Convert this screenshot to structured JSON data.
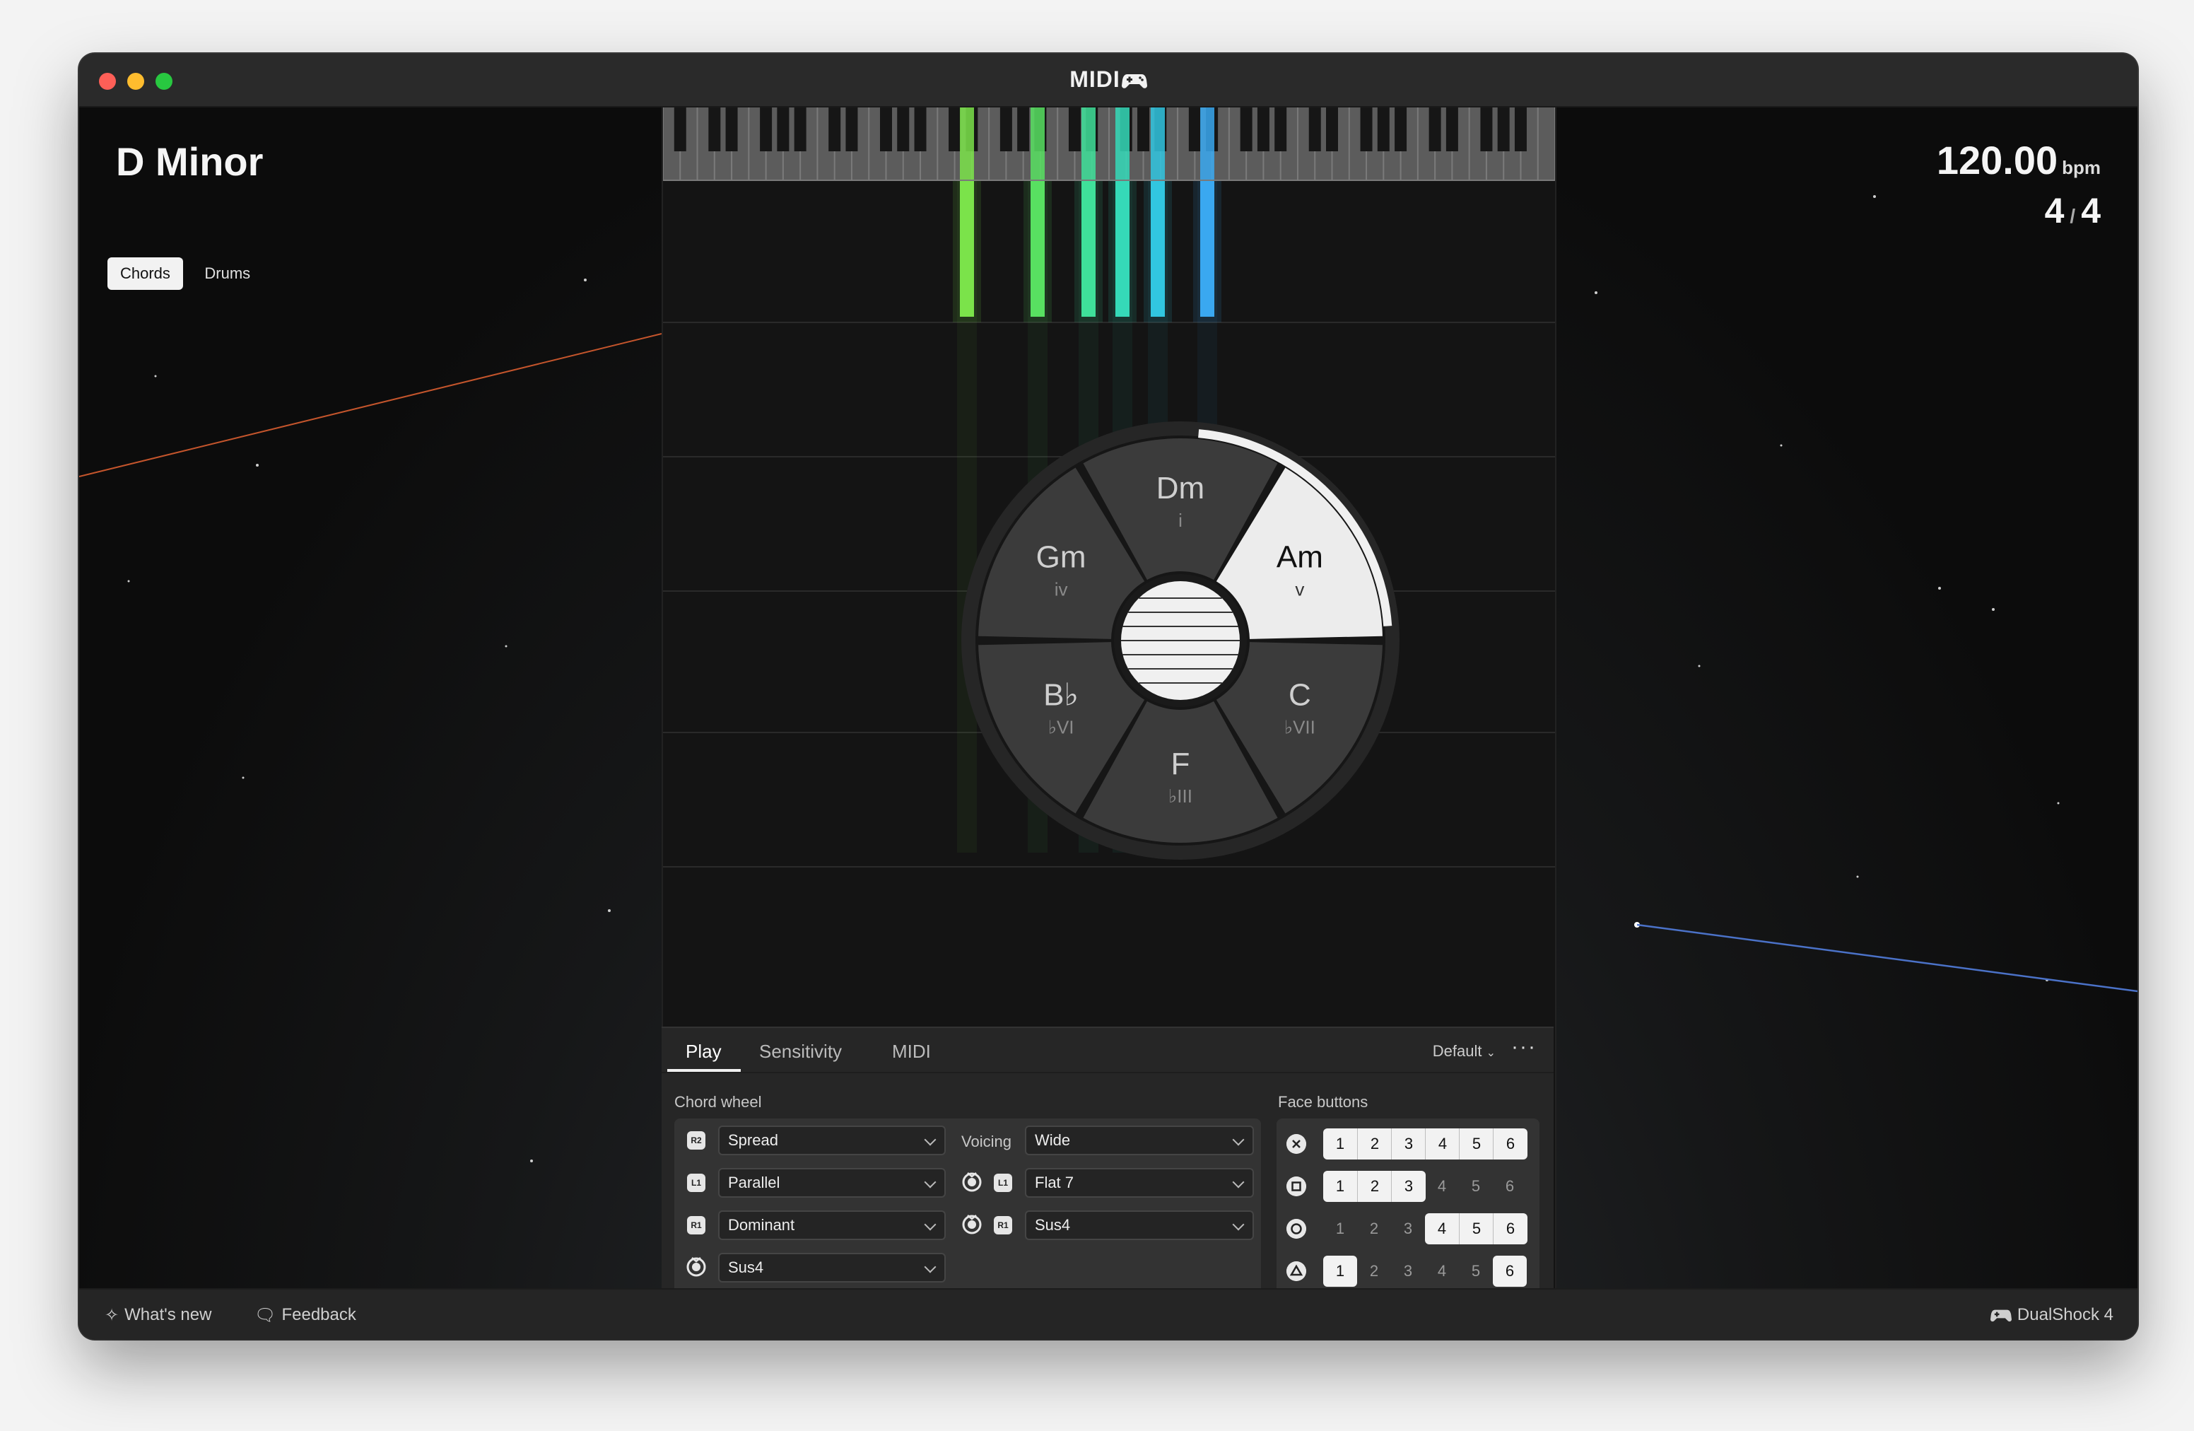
{
  "app": {
    "title": "MIDI"
  },
  "key": {
    "name": "D Minor"
  },
  "modes": [
    {
      "label": "Chords",
      "active": true
    },
    {
      "label": "Drums",
      "active": false
    }
  ],
  "tempo": {
    "bpm": "120.00",
    "unit": "bpm",
    "numerator": "4",
    "slash": "/",
    "denominator": "4"
  },
  "wheel": {
    "segments": [
      {
        "name": "Dm",
        "degree": "i",
        "active": false
      },
      {
        "name": "Am",
        "degree": "v",
        "active": true
      },
      {
        "name": "C",
        "degree": "♭VII",
        "active": false
      },
      {
        "name": "F",
        "degree": "♭III",
        "active": false
      },
      {
        "name": "B♭",
        "degree": "♭VI",
        "active": false
      },
      {
        "name": "Gm",
        "degree": "iv",
        "active": false
      }
    ]
  },
  "settings": {
    "tabs": [
      "Play",
      "Sensitivity",
      "MIDI"
    ],
    "active_tab": "Play",
    "preset": "Default",
    "more_icon": "ellipsis-icon",
    "chord_wheel": {
      "title": "Chord wheel",
      "rows": [
        {
          "badge": "R2",
          "value": "Spread"
        },
        {
          "badge": "L1",
          "value": "Parallel"
        },
        {
          "badge": "R1",
          "value": "Dominant"
        },
        {
          "badge": "stick",
          "value": "Sus4"
        }
      ],
      "voicing_label": "Voicing",
      "right_rows": [
        {
          "icons": [],
          "value": "Wide"
        },
        {
          "icons": [
            "stick",
            "L1"
          ],
          "value": "Flat 7"
        },
        {
          "icons": [
            "stick",
            "R1"
          ],
          "value": "Sus4"
        }
      ]
    },
    "face_buttons": {
      "title": "Face buttons",
      "rows": [
        {
          "button": "cross",
          "cells": [
            "1",
            "2",
            "3",
            "4",
            "5",
            "6"
          ],
          "on": [
            1,
            1,
            1,
            1,
            1,
            1
          ]
        },
        {
          "button": "square",
          "cells": [
            "1",
            "2",
            "3",
            "4",
            "5",
            "6"
          ],
          "on": [
            1,
            1,
            1,
            0,
            0,
            0
          ]
        },
        {
          "button": "circle",
          "cells": [
            "1",
            "2",
            "3",
            "4",
            "5",
            "6"
          ],
          "on": [
            0,
            0,
            0,
            1,
            1,
            1
          ]
        },
        {
          "button": "triangle",
          "cells": [
            "1",
            "2",
            "3",
            "4",
            "5",
            "6"
          ],
          "on": [
            1,
            0,
            0,
            0,
            0,
            1
          ]
        }
      ]
    }
  },
  "footer": {
    "whats_new": "What's new",
    "feedback": "Feedback",
    "controller": "DualShock 4"
  },
  "colors": {
    "note_bars": [
      "#7be34a",
      "#58e061",
      "#3fe09a",
      "#35d9b8",
      "#31c6e0",
      "#3aa8f0"
    ]
  }
}
